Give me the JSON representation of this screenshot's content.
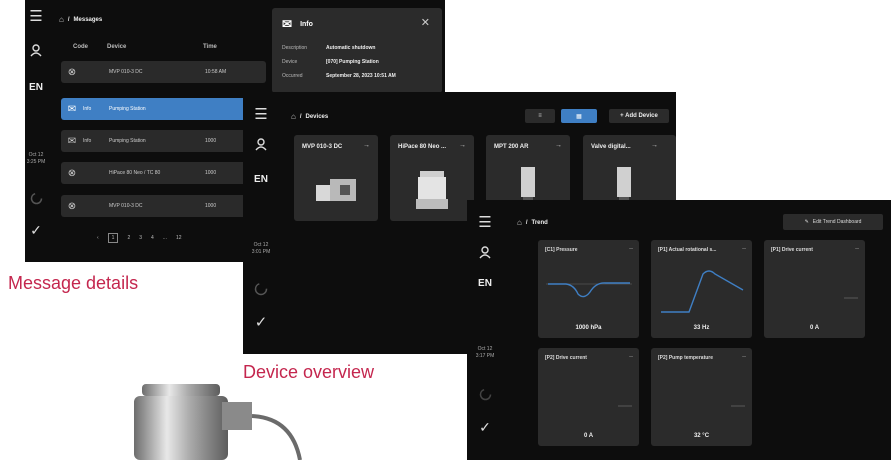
{
  "captions": {
    "message_details": "Message details",
    "device_overview": "Device overview"
  },
  "rail": {
    "lang": "EN"
  },
  "messages": {
    "breadcrumb": "Messages",
    "headers": [
      "Code",
      "Device",
      "Time"
    ],
    "rows": [
      {
        "icon": "⊗",
        "code": "",
        "device": "MVP 010-3 DC",
        "time": "10:58 AM"
      },
      {
        "icon": "✉",
        "code": "Info",
        "device": "Pumping Station",
        "time": ""
      },
      {
        "icon": "✉",
        "code": "Info",
        "device": "Pumping Station",
        "time": "1000"
      },
      {
        "icon": "⊗",
        "code": "",
        "device": "HiPace 80 Neo / TC 80",
        "time": "1000"
      },
      {
        "icon": "⊗",
        "code": "",
        "device": "MVP 010-3 DC",
        "time": "1000"
      }
    ],
    "date": "Oct 12",
    "time": "3:25 PM",
    "pager": [
      "1",
      "2",
      "3",
      "4",
      "...",
      "12"
    ],
    "info": {
      "title": "Info",
      "rows": [
        {
          "k": "Description",
          "v": "Automatic shutdown"
        },
        {
          "k": "Device",
          "v": "[070] Pumping Station"
        },
        {
          "k": "Occurred",
          "v": "September 28, 2023 10:51 AM"
        }
      ]
    }
  },
  "devices": {
    "breadcrumb": "Devices",
    "add_label": "+ Add Device",
    "date": "Oct 12",
    "time": "3:01 PM",
    "cards": [
      {
        "name": "MVP 010-3 DC"
      },
      {
        "name": "HiPace 80 Neo ..."
      },
      {
        "name": "MPT 200 AR"
      },
      {
        "name": "Valve digital..."
      }
    ]
  },
  "trend": {
    "breadcrumb": "Trend",
    "edit_label": "Edit Trend Dashboard",
    "date": "Oct 12",
    "time": "3:17 PM",
    "cards": [
      {
        "name": "[C1] Pressure",
        "value": "1000 hPa"
      },
      {
        "name": "[P1] Actual rotational s...",
        "value": "33 Hz"
      },
      {
        "name": "[P1] Drive current",
        "value": "0 A"
      },
      {
        "name": "[P2] Drive current",
        "value": "0 A"
      },
      {
        "name": "[P2] Pump temperature",
        "value": "32 °C"
      }
    ]
  }
}
